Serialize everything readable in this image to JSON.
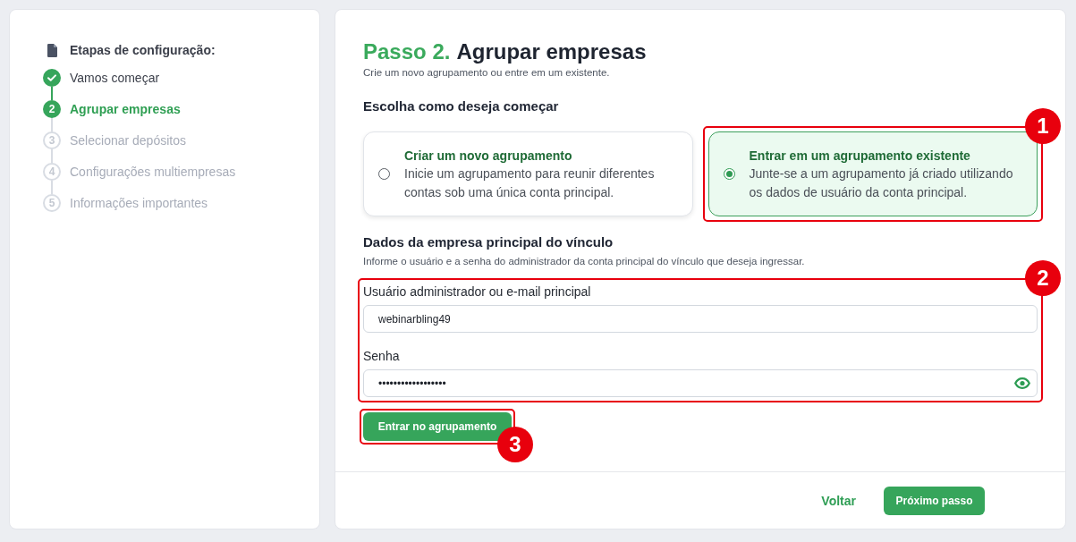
{
  "sidebar": {
    "title": "Etapas de configuração:",
    "steps": [
      {
        "label": "Vamos começar",
        "kind": "done"
      },
      {
        "number": "2",
        "label": "Agrupar empresas",
        "kind": "current"
      },
      {
        "number": "3",
        "label": "Selecionar depósitos",
        "kind": "pending"
      },
      {
        "number": "4",
        "label": "Configurações multiempresas",
        "kind": "pending"
      },
      {
        "number": "5",
        "label": "Informações importantes",
        "kind": "pending"
      }
    ]
  },
  "header": {
    "step": "Passo 2.",
    "title": "Agrupar empresas",
    "subtitle": "Crie um novo agrupamento ou entre em um existente."
  },
  "choice": {
    "heading": "Escolha como deseja começar",
    "options": [
      {
        "title": "Criar um novo agrupamento",
        "description": "Inicie um agrupamento para reunir diferentes contas sob uma única conta principal.",
        "selected": false
      },
      {
        "title": "Entrar em um agrupamento existente",
        "description": "Junte-se a um agrupamento já criado utilizando os dados de usuário da conta principal.",
        "selected": true,
        "annotation": "1"
      }
    ]
  },
  "link_section": {
    "heading": "Dados da empresa principal do vínculo",
    "subtitle": "Informe o usuário e a senha do administrador da conta principal do vínculo que deseja ingressar.",
    "annotation": "2",
    "fields": [
      {
        "kind": "text",
        "label": "Usuário administrador ou e-mail principal",
        "value": "webinarbling49"
      },
      {
        "kind": "password",
        "label": "Senha",
        "value": "••••••••••••••••••"
      }
    ],
    "submit": {
      "label": "Entrar no agrupamento",
      "annotation": "3"
    }
  },
  "footer": {
    "back": "Voltar",
    "next": "Próximo passo"
  }
}
